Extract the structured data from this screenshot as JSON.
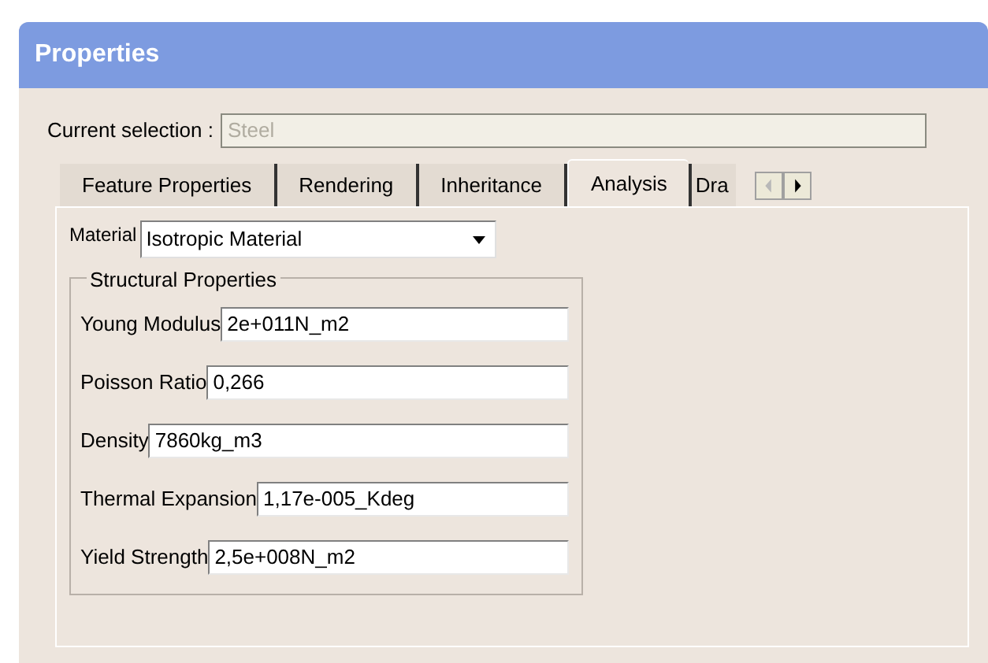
{
  "window": {
    "title": "Properties"
  },
  "current_selection": {
    "label": "Current selection :",
    "value": "Steel",
    "disabled": true
  },
  "tabs": [
    {
      "label": "Feature Properties",
      "selected": false
    },
    {
      "label": "Rendering",
      "selected": false
    },
    {
      "label": "Inheritance",
      "selected": false
    },
    {
      "label": "Analysis",
      "selected": true
    },
    {
      "label": "Dra",
      "selected": false
    }
  ],
  "tab_scroll": [
    {
      "kind": "left",
      "disabled": true
    },
    {
      "kind": "right",
      "disabled": false
    }
  ],
  "material": {
    "label": "Material",
    "value": "Isotropic Material"
  },
  "structural_properties": {
    "title": "Structural Properties",
    "fields": [
      {
        "label": "Young Modulus",
        "value": "2e+011N_m2"
      },
      {
        "label": "Poisson Ratio",
        "value": "0,266"
      },
      {
        "label": "Density",
        "value": "7860kg_m3"
      },
      {
        "label": "Thermal Expansion",
        "value": "1,17e-005_Kdeg"
      },
      {
        "label": "Yield Strength",
        "value": "2,5e+008N_m2"
      }
    ]
  }
}
